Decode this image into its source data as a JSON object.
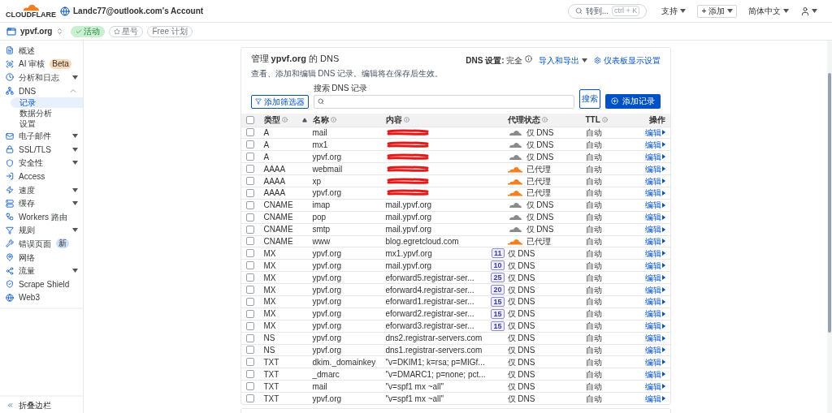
{
  "header": {
    "logo": "CLOUDFLARE",
    "account": "Landc77@outlook.com's Account",
    "search": {
      "placeholder": "转到...",
      "shortcut": "ctrl + K"
    },
    "menus": [
      {
        "label": "支持",
        "kind": "plain"
      },
      {
        "label": "+ 添加",
        "kind": "outlined"
      },
      {
        "label": "简体中文",
        "kind": "plain"
      }
    ]
  },
  "site": {
    "domain": "ypvf.org",
    "badges": [
      {
        "label": "活动",
        "kind": "status"
      },
      {
        "label": "星号",
        "kind": "star"
      },
      {
        "label": "Free 计划",
        "kind": "plan"
      }
    ]
  },
  "sidebar": {
    "items": [
      {
        "label": "概述"
      },
      {
        "label": "AI 审核",
        "badge": "Beta",
        "color": "#fbd8b8"
      },
      {
        "label": "分析和日志",
        "expanded": false
      },
      {
        "label": "DNS",
        "expanded": true,
        "children": [
          {
            "label": "记录",
            "selected": true
          },
          {
            "label": "数据分析",
            "selected": false
          },
          {
            "label": "设置",
            "selected": false
          }
        ]
      },
      {
        "label": "电子邮件",
        "expanded": false
      },
      {
        "label": "SSL/TLS",
        "expanded": false
      },
      {
        "label": "安全性",
        "expanded": false
      },
      {
        "label": "Access"
      },
      {
        "label": "速度",
        "expanded": false
      },
      {
        "label": "缓存",
        "expanded": false
      },
      {
        "label": "Workers 路由"
      },
      {
        "label": "规则",
        "expanded": false
      },
      {
        "label": "错误页面",
        "badge": "新",
        "color": "#cfe1fa"
      },
      {
        "label": "网络"
      },
      {
        "label": "流量",
        "expanded": false
      },
      {
        "label": "Scrape Shield"
      },
      {
        "label": "Web3"
      }
    ],
    "collapse": "折叠边栏"
  },
  "dns": {
    "title": "管理 **ypvf.org** 的 DNS",
    "description": "查看、添加和编辑 DNS 记录。编辑将在保存后生效。",
    "setting_label": "DNS 设置:",
    "setting_value": "完全",
    "import_export": "导入和导出",
    "display_settings": "仪表板显示设置",
    "filter_button": "添加筛选器",
    "search_label": "搜索 DNS 记录",
    "search_button": "搜索",
    "add_button": "添加记录",
    "select_all": {
      "checked": false
    },
    "columns": [
      {
        "label": "类型",
        "info": true,
        "sorted": true
      },
      {
        "label": "名称",
        "info": true,
        "sorted": false
      },
      {
        "label": "内容",
        "info": true,
        "sorted": false
      },
      {
        "label": "代理状态",
        "info": true,
        "sorted": false
      },
      {
        "label": "TTL",
        "info": true,
        "sorted": false
      },
      {
        "label": "操作",
        "info": false,
        "sorted": false
      }
    ],
    "rows": [
      {
        "checked": false,
        "type": "A",
        "name": "mail",
        "redacted": true,
        "proxy": "仅 DNS",
        "proxied": false,
        "ttl": "自动",
        "action": "编辑"
      },
      {
        "checked": false,
        "type": "A",
        "name": "mx1",
        "redacted": true,
        "proxy": "仅 DNS",
        "proxied": false,
        "ttl": "自动",
        "action": "编辑"
      },
      {
        "checked": false,
        "type": "A",
        "name": "ypvf.org",
        "redacted": true,
        "proxy": "仅 DNS",
        "proxied": false,
        "ttl": "自动",
        "action": "编辑"
      },
      {
        "checked": false,
        "type": "AAAA",
        "name": "webmail",
        "redacted": true,
        "proxy": "已代理",
        "proxied": true,
        "ttl": "自动",
        "action": "编辑"
      },
      {
        "checked": false,
        "type": "AAAA",
        "name": "xp",
        "redacted": true,
        "proxy": "已代理",
        "proxied": true,
        "ttl": "自动",
        "action": "编辑"
      },
      {
        "checked": false,
        "type": "AAAA",
        "name": "ypvf.org",
        "redacted": true,
        "proxy": "已代理",
        "proxied": true,
        "ttl": "自动",
        "action": "编辑"
      },
      {
        "checked": false,
        "type": "CNAME",
        "name": "imap",
        "content": "mail.ypvf.org",
        "proxy": "仅 DNS",
        "proxied": false,
        "ttl": "自动",
        "action": "编辑"
      },
      {
        "checked": false,
        "type": "CNAME",
        "name": "pop",
        "content": "mail.ypvf.org",
        "proxy": "仅 DNS",
        "proxied": false,
        "ttl": "自动",
        "action": "编辑"
      },
      {
        "checked": false,
        "type": "CNAME",
        "name": "smtp",
        "content": "mail.ypvf.org",
        "proxy": "仅 DNS",
        "proxied": false,
        "ttl": "自动",
        "action": "编辑"
      },
      {
        "checked": false,
        "type": "CNAME",
        "name": "www",
        "content": "blog.egretcloud.com",
        "proxy": "已代理",
        "proxied": true,
        "ttl": "自动",
        "action": "编辑"
      },
      {
        "checked": false,
        "type": "MX",
        "name": "ypvf.org",
        "content": "mx1.ypvf.org",
        "priority": "11",
        "proxy": "仅 DNS",
        "ttl": "自动",
        "action": "编辑"
      },
      {
        "checked": false,
        "type": "MX",
        "name": "ypvf.org",
        "content": "mail.ypvf.org",
        "priority": "10",
        "proxy": "仅 DNS",
        "ttl": "自动",
        "action": "编辑"
      },
      {
        "checked": false,
        "type": "MX",
        "name": "ypvf.org",
        "content": "eforward5.registrar-ser...",
        "priority": "25",
        "proxy": "仅 DNS",
        "ttl": "自动",
        "action": "编辑"
      },
      {
        "checked": false,
        "type": "MX",
        "name": "ypvf.org",
        "content": "eforward4.registrar-ser...",
        "priority": "20",
        "proxy": "仅 DNS",
        "ttl": "自动",
        "action": "编辑"
      },
      {
        "checked": false,
        "type": "MX",
        "name": "ypvf.org",
        "content": "eforward1.registrar-ser...",
        "priority": "15",
        "proxy": "仅 DNS",
        "ttl": "自动",
        "action": "编辑"
      },
      {
        "checked": false,
        "type": "MX",
        "name": "ypvf.org",
        "content": "eforward2.registrar-ser...",
        "priority": "15",
        "proxy": "仅 DNS",
        "ttl": "自动",
        "action": "编辑"
      },
      {
        "checked": false,
        "type": "MX",
        "name": "ypvf.org",
        "content": "eforward3.registrar-ser...",
        "priority": "15",
        "proxy": "仅 DNS",
        "ttl": "自动",
        "action": "编辑"
      },
      {
        "checked": false,
        "type": "NS",
        "name": "ypvf.org",
        "content": "dns2.registrar-servers.com",
        "proxy": "仅 DNS",
        "ttl": "自动",
        "action": "编辑"
      },
      {
        "checked": false,
        "type": "NS",
        "name": "ypvf.org",
        "content": "dns1.registrar-servers.com",
        "proxy": "仅 DNS",
        "ttl": "自动",
        "action": "编辑"
      },
      {
        "checked": false,
        "type": "TXT",
        "name": "dkim._domainkey",
        "content": "\"v=DKIM1; k=rsa; p=MIGf...",
        "proxy": "仅 DNS",
        "ttl": "自动",
        "action": "编辑"
      },
      {
        "checked": false,
        "type": "TXT",
        "name": "_dmarc",
        "content": "\"v=DMARC1; p=none; pct...",
        "proxy": "仅 DNS",
        "ttl": "自动",
        "action": "编辑"
      },
      {
        "checked": false,
        "type": "TXT",
        "name": "mail",
        "content": "\"v=spf1 mx ~all\"",
        "proxy": "仅 DNS",
        "ttl": "自动",
        "action": "编辑"
      },
      {
        "checked": false,
        "type": "TXT",
        "name": "ypvf.org",
        "content": "\"v=spf1 mx ~all\"",
        "proxy": "仅 DNS",
        "ttl": "自动",
        "action": "编辑"
      }
    ]
  }
}
